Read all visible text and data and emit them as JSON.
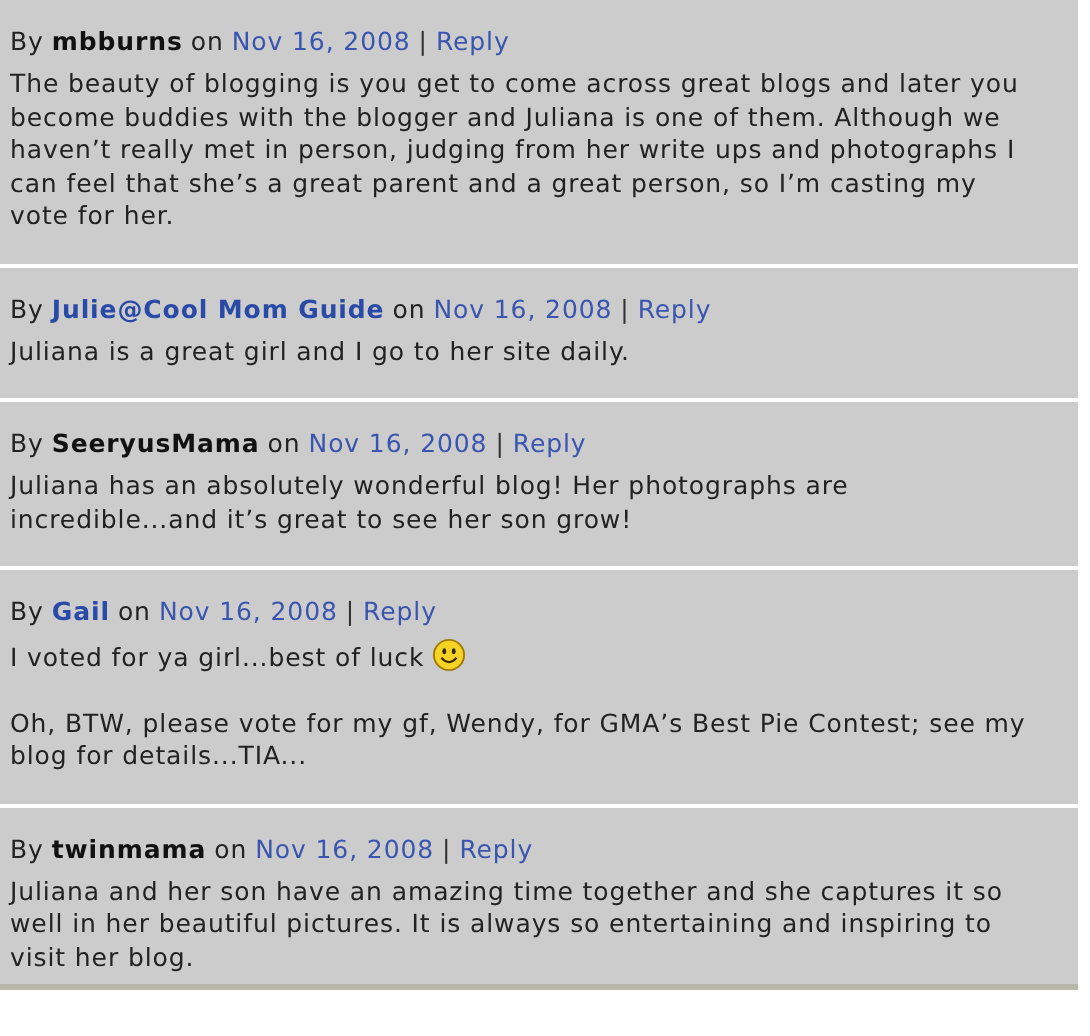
{
  "comments": [
    {
      "by": "By",
      "author": "mbburns",
      "author_linked": false,
      "on": "on",
      "date": "Nov 16, 2008",
      "separator": "|",
      "reply": "Reply",
      "paragraphs": [
        {
          "text": "The beauty of blogging is you get to come across great blogs and later you become buddies with the blogger and Juliana is one of them. Although we haven’t really met in person, judging from her write ups and photographs I can feel that she’s a great parent and a great person, so I’m casting my vote for her.",
          "smiley": false
        }
      ]
    },
    {
      "by": "By",
      "author": "Julie@Cool Mom Guide",
      "author_linked": true,
      "on": "on",
      "date": "Nov 16, 2008",
      "separator": "|",
      "reply": "Reply",
      "paragraphs": [
        {
          "text": "Juliana is a great girl and I go to her site daily.",
          "smiley": false
        }
      ]
    },
    {
      "by": "By",
      "author": "SeeryusMama",
      "author_linked": false,
      "on": "on",
      "date": "Nov 16, 2008",
      "separator": "|",
      "reply": "Reply",
      "paragraphs": [
        {
          "text": "Juliana has an absolutely wonderful blog! Her photographs are incredible...and it’s great to see her son grow!",
          "smiley": false
        }
      ]
    },
    {
      "by": "By",
      "author": "Gail",
      "author_linked": true,
      "on": "on",
      "date": "Nov 16, 2008",
      "separator": "|",
      "reply": "Reply",
      "paragraphs": [
        {
          "text": "I voted for ya girl...best of luck",
          "smiley": true
        },
        {
          "text": "Oh, BTW, please vote for my gf, Wendy, for GMA’s Best Pie Contest; see my blog for details...TIA...",
          "smiley": false
        }
      ]
    },
    {
      "by": "By",
      "author": "twinmama",
      "author_linked": false,
      "on": "on",
      "date": "Nov 16, 2008",
      "separator": "|",
      "reply": "Reply",
      "paragraphs": [
        {
          "text": "Juliana and her son have an amazing time together and she captures it so well in her beautiful pictures. It is always so entertaining and inspiring to visit her blog.",
          "smiley": false
        }
      ]
    }
  ]
}
